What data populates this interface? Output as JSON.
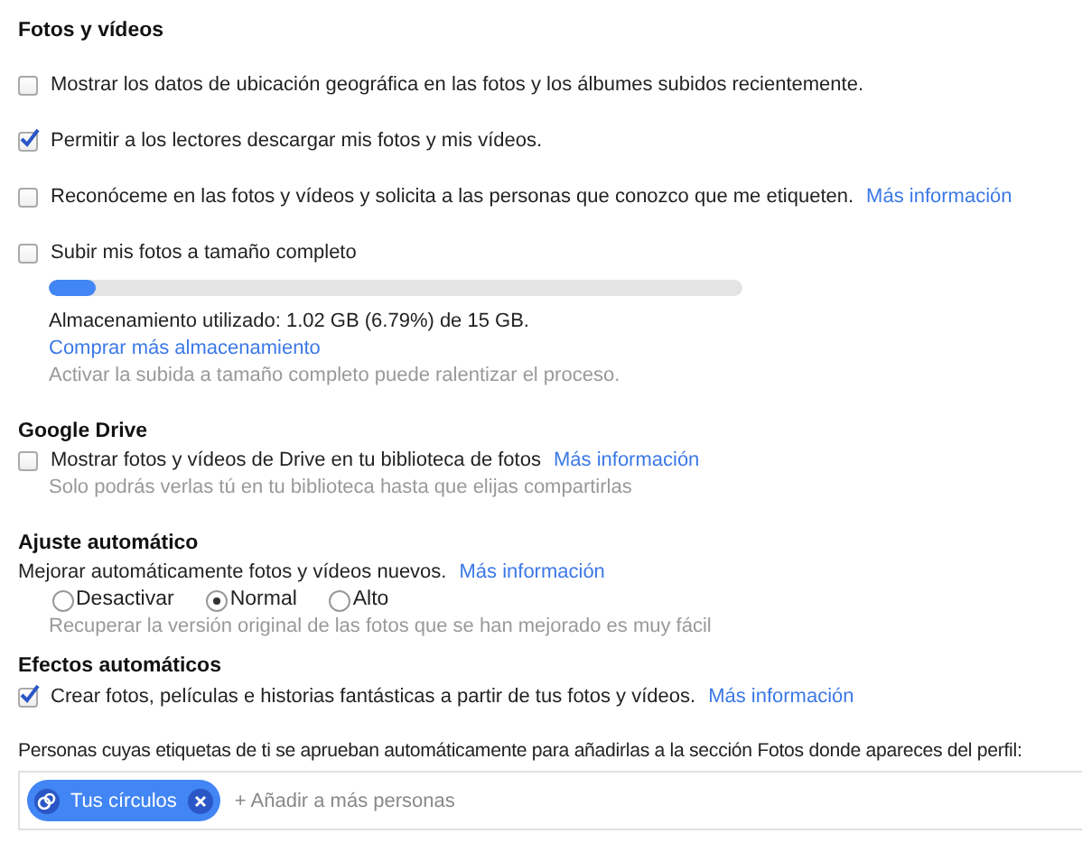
{
  "photos": {
    "title": "Fotos y vídeos",
    "options": [
      {
        "label": "Mostrar los datos de ubicación geográfica en las fotos y los álbumes subidos recientemente.",
        "checked": false
      },
      {
        "label": "Permitir a los lectores descargar mis fotos y mis vídeos.",
        "checked": true
      },
      {
        "label": "Reconóceme en las fotos y vídeos y solicita a las personas que conozco que me etiqueten.",
        "checked": false,
        "link": "Más información"
      },
      {
        "label": "Subir mis fotos a tamaño completo",
        "checked": false
      }
    ],
    "storage": {
      "level": 0.068,
      "usage": "Almacenamiento utilizado: 1.02 GB (6.79%) de 15 GB.",
      "buy_link": "Comprar más almacenamiento",
      "note": "Activar la subida a tamaño completo puede ralentizar el proceso."
    }
  },
  "drive": {
    "title": "Google Drive",
    "option": {
      "label": "Mostrar fotos y vídeos de Drive en tu biblioteca de fotos",
      "checked": false,
      "link": "Más información"
    },
    "note": "Solo podrás verlas tú en tu biblioteca hasta que elijas compartirlas"
  },
  "auto_enhance": {
    "title": "Ajuste automático",
    "description": "Mejorar automáticamente fotos y vídeos nuevos.",
    "link": "Más información",
    "radios": [
      {
        "label": "Desactivar",
        "selected": false
      },
      {
        "label": "Normal",
        "selected": true
      },
      {
        "label": "Alto",
        "selected": false
      }
    ],
    "note": "Recuperar la versión original de las fotos que se han mejorado es muy fácil"
  },
  "auto_effects": {
    "title": "Efectos automáticos",
    "option": {
      "label": "Crear fotos, películas e historias fantásticas a partir de tus fotos y vídeos.",
      "checked": true,
      "link": "Más información"
    }
  },
  "tag_approval": {
    "label": "Personas cuyas etiquetas de ti se aprueban automáticamente para añadirlas a la sección Fotos donde apareces del perfil:",
    "chips": [
      {
        "label": "Tus círculos"
      }
    ],
    "add_placeholder": "+ Añadir a más personas"
  }
}
